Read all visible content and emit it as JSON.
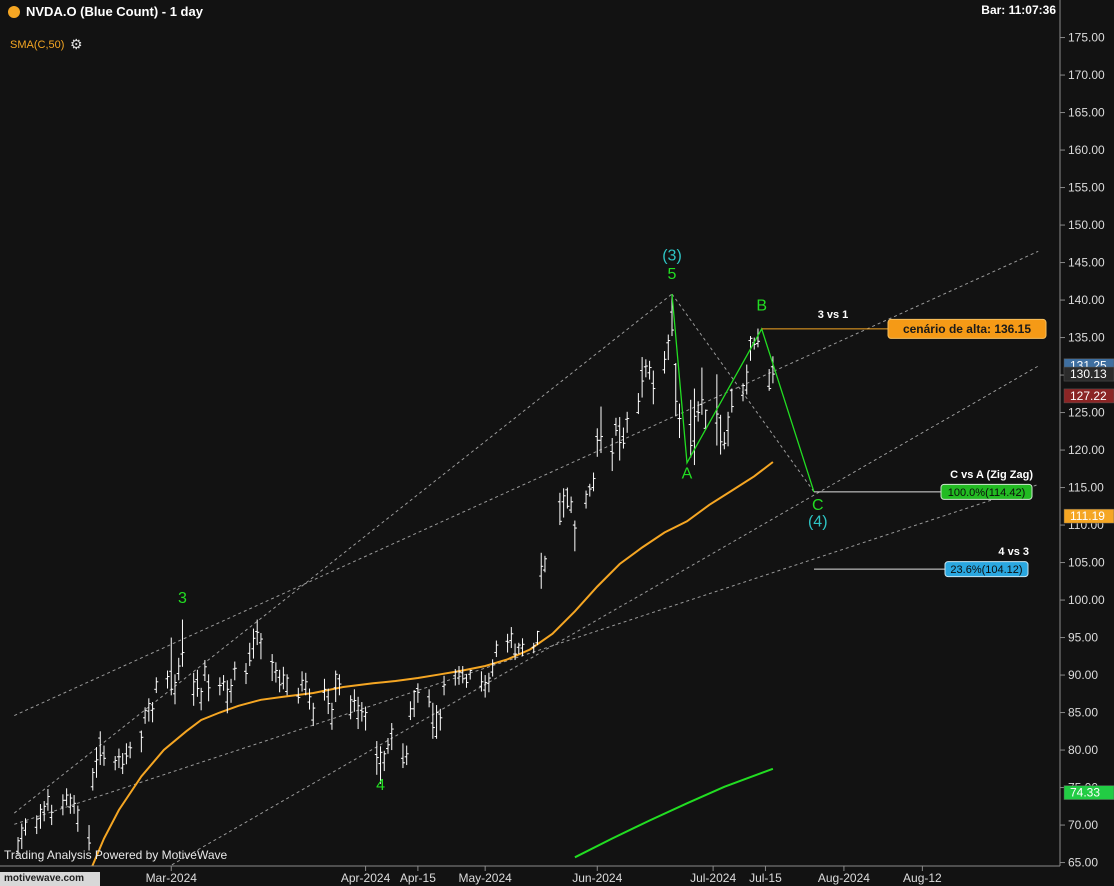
{
  "header": {
    "title": "NVDA.O (Blue Count) - 1 day",
    "bar_time": "Bar: 11:07:36",
    "indicator": "SMA(C,50)",
    "settings_icon": "gear-icon"
  },
  "footer": {
    "powered_by": "Trading Analysis Powered by MotiveWave",
    "logo": "motivewave.com"
  },
  "colors": {
    "background": "#121212",
    "candles": "#ffffff",
    "sma": "#f5a623",
    "wave_green": "#22dd22",
    "wave_cyan": "#2ec4c4",
    "guide": "#9a9a9a"
  },
  "chart_data": {
    "type": "ohlc",
    "x_axis_labels": [
      "Mar-2024",
      "Apr-2024",
      "Apr-15",
      "May-2024",
      "Jun-2024",
      "Jul-2024",
      "Jul-15",
      "Aug-2024",
      "Aug-12"
    ],
    "x_label_day_index": [
      42,
      94,
      108,
      126,
      156,
      187,
      201,
      222,
      243
    ],
    "y_ticks": [
      65,
      70,
      75,
      80,
      85,
      90,
      95,
      100,
      105,
      110,
      115,
      120,
      125,
      130,
      135,
      140,
      145,
      150,
      155,
      160,
      165,
      170,
      175
    ],
    "y_tick_labels": [
      "65.00",
      "70.00",
      "75.00",
      "80.00",
      "85.00",
      "90.00",
      "95.00",
      "100.00",
      "105.00",
      "110.00",
      "115.00",
      "120.00",
      "125.00",
      "130.00",
      "135.00",
      "140.00",
      "145.00",
      "150.00",
      "155.00",
      "160.00",
      "165.00",
      "170.00",
      "175.00"
    ],
    "ylim": [
      63.5,
      176.5
    ],
    "xlim_days": [
      0,
      260
    ],
    "bars": [
      [
        1,
        66.5,
        68.4,
        65.9,
        67.9
      ],
      [
        2,
        68.2,
        70.2,
        66.8,
        69.6
      ],
      [
        3,
        69.3,
        70.9,
        68.6,
        70.4
      ],
      [
        6,
        69.7,
        71.3,
        68.8,
        70.8
      ],
      [
        7,
        70.9,
        72.8,
        69.5,
        72.1
      ],
      [
        8,
        71.7,
        73.2,
        70.5,
        72.5
      ],
      [
        9,
        72.8,
        74.8,
        71.9,
        73.8
      ],
      [
        10,
        71.0,
        72.7,
        70.0,
        71.7
      ],
      [
        13,
        72.4,
        74.1,
        71.3,
        73.3
      ],
      [
        14,
        73.3,
        74.9,
        72.6,
        74.0
      ],
      [
        15,
        72.4,
        74.2,
        71.5,
        73.6
      ],
      [
        16,
        72.5,
        74.0,
        71.5,
        72.9
      ],
      [
        17,
        70.2,
        72.6,
        69.1,
        72.0
      ],
      [
        20,
        68.3,
        70.0,
        66.6,
        67.6
      ],
      [
        21,
        75.1,
        77.6,
        74.6,
        77.0
      ],
      [
        22,
        78.5,
        80.4,
        76.3,
        78.7
      ],
      [
        23,
        81.6,
        82.5,
        78.0,
        79.3
      ],
      [
        24,
        79.6,
        80.6,
        77.9,
        78.9
      ],
      [
        27,
        78.4,
        79.2,
        77.3,
        78.6
      ],
      [
        28,
        79.1,
        80.2,
        77.6,
        79.1
      ],
      [
        29,
        77.6,
        79.6,
        76.8,
        78.1
      ],
      [
        30,
        79.5,
        80.9,
        78.1,
        79.2
      ],
      [
        31,
        80.4,
        81.1,
        78.9,
        80.3
      ],
      [
        34,
        82.4,
        82.6,
        79.7,
        81.7
      ],
      [
        35,
        84.3,
        85.7,
        83.5,
        85.3
      ],
      [
        36,
        85.2,
        86.9,
        83.8,
        86.2
      ],
      [
        37,
        85.3,
        86.4,
        83.7,
        85.5
      ],
      [
        38,
        88.1,
        89.7,
        87.6,
        89.1
      ],
      [
        41,
        89.5,
        90.6,
        88.2,
        89.8
      ],
      [
        42,
        90.5,
        95.0,
        87.3,
        88.1
      ],
      [
        43,
        87.5,
        90.1,
        86.1,
        89.0
      ],
      [
        44,
        90.2,
        92.3,
        89.3,
        91.2
      ],
      [
        45,
        92.8,
        97.4,
        91.1,
        93.0
      ],
      [
        48,
        87.4,
        90.3,
        85.9,
        89.1
      ],
      [
        49,
        89.4,
        90.7,
        87.1,
        88.2
      ],
      [
        50,
        86.3,
        88.3,
        85.3,
        87.8
      ],
      [
        51,
        90.0,
        92.0,
        89.2,
        91.1
      ],
      [
        52,
        89.1,
        90.1,
        86.5,
        88.3
      ],
      [
        55,
        88.6,
        89.7,
        87.3,
        88.6
      ],
      [
        56,
        88.9,
        90.0,
        87.9,
        89.1
      ],
      [
        57,
        86.4,
        89.3,
        84.9,
        88.1
      ],
      [
        58,
        87.8,
        89.5,
        86.3,
        88.6
      ],
      [
        59,
        90.8,
        91.8,
        89.3,
        90.9
      ],
      [
        62,
        90.5,
        91.6,
        88.8,
        90.2
      ],
      [
        63,
        92.9,
        94.3,
        91.2,
        91.9
      ],
      [
        64,
        93.5,
        96.2,
        92.2,
        94.9
      ],
      [
        65,
        95.8,
        97.4,
        94.0,
        95.7
      ],
      [
        66,
        94.3,
        95.6,
        92.1,
        94.8
      ],
      [
        69,
        91.8,
        92.8,
        89.2,
        91.7
      ],
      [
        70,
        90.4,
        91.7,
        89.0,
        90.6
      ],
      [
        71,
        89.7,
        90.7,
        87.7,
        88.7
      ],
      [
        72,
        88.9,
        91.1,
        88.1,
        90.0
      ],
      [
        73,
        87.8,
        90.1,
        87.3,
        89.6
      ],
      [
        76,
        87.2,
        88.3,
        86.2,
        87.0
      ],
      [
        77,
        88.7,
        90.5,
        87.8,
        89.3
      ],
      [
        78,
        88.1,
        90.3,
        87.3,
        89.1
      ],
      [
        79,
        86.4,
        88.2,
        85.4,
        87.1
      ],
      [
        80,
        84.0,
        86.3,
        83.2,
        85.6
      ],
      [
        83,
        87.7,
        89.5,
        86.6,
        88.1
      ],
      [
        84,
        87.1,
        88.2,
        84.8,
        86.2
      ],
      [
        85,
        83.5,
        86.3,
        82.7,
        85.4
      ],
      [
        86,
        88.3,
        90.6,
        86.4,
        90.1
      ],
      [
        87,
        89.5,
        90.1,
        87.3,
        88.8
      ],
      [
        90,
        84.7,
        87.3,
        84.1,
        86.7
      ],
      [
        91,
        86.5,
        88.1,
        85.1,
        86.6
      ],
      [
        92,
        84.2,
        87.1,
        82.8,
        85.9
      ],
      [
        93,
        85.3,
        86.4,
        83.8,
        85.1
      ],
      [
        94,
        84.5,
        85.8,
        82.6,
        85.0
      ],
      [
        97,
        79.4,
        81.2,
        76.7,
        79.0
      ],
      [
        98,
        78.2,
        80.5,
        75.5,
        79.7
      ],
      [
        99,
        78.3,
        79.9,
        77.2,
        79.5
      ],
      [
        100,
        80.2,
        81.6,
        79.5,
        80.7
      ],
      [
        101,
        82.2,
        83.6,
        80.0,
        82.8
      ],
      [
        104,
        78.9,
        80.9,
        77.6,
        78.3
      ],
      [
        105,
        79.1,
        80.6,
        78.0,
        79.5
      ],
      [
        106,
        84.5,
        86.5,
        84.0,
        85.5
      ],
      [
        107,
        85.5,
        88.0,
        84.4,
        87.8
      ],
      [
        108,
        88.2,
        88.9,
        86.3,
        87.7
      ],
      [
        111,
        87.1,
        88.1,
        85.7,
        86.4
      ],
      [
        112,
        83.6,
        86.3,
        81.5,
        83.0
      ],
      [
        113,
        81.8,
        86.0,
        81.5,
        85.0
      ],
      [
        114,
        84.8,
        85.5,
        82.6,
        84.3
      ],
      [
        115,
        88.5,
        89.9,
        87.3,
        88.7
      ],
      [
        118,
        89.9,
        90.8,
        88.6,
        90.4
      ],
      [
        119,
        89.6,
        91.2,
        88.7,
        90.4
      ],
      [
        120,
        90.3,
        91.2,
        88.9,
        89.5
      ],
      [
        121,
        89.6,
        90.1,
        88.3,
        89.0
      ],
      [
        122,
        90.1,
        90.7,
        89.4,
        90.6
      ],
      [
        125,
        88.5,
        90.5,
        87.8,
        89.1
      ],
      [
        126,
        88.0,
        90.0,
        87.0,
        89.0
      ],
      [
        127,
        88.9,
        90.3,
        87.7,
        89.6
      ],
      [
        128,
        90.4,
        92.1,
        89.8,
        91.5
      ],
      [
        129,
        93.0,
        94.6,
        92.4,
        94.0
      ],
      [
        132,
        94.5,
        95.5,
        93.0,
        94.4
      ],
      [
        133,
        94.6,
        96.4,
        93.6,
        95.5
      ],
      [
        134,
        92.8,
        94.2,
        92.0,
        92.8
      ],
      [
        135,
        93.7,
        94.3,
        92.8,
        94.0
      ],
      [
        136,
        93.6,
        94.9,
        92.5,
        94.1
      ],
      [
        139,
        93.7,
        94.3,
        92.9,
        93.9
      ],
      [
        140,
        94.3,
        95.9,
        94.0,
        95.8
      ],
      [
        141,
        103.2,
        106.3,
        101.5,
        104.5
      ],
      [
        142,
        104.0,
        105.9,
        103.7,
        105.5
      ],
      [
        146,
        113.1,
        114.3,
        110.0,
        110.5
      ],
      [
        147,
        113.1,
        114.9,
        111.0,
        113.9
      ],
      [
        148,
        114.7,
        115.0,
        112.2,
        112.5
      ],
      [
        149,
        112.0,
        113.8,
        111.6,
        113.1
      ],
      [
        150,
        110.0,
        110.6,
        106.5,
        109.6
      ],
      [
        153,
        112.9,
        114.6,
        112.2,
        114.1
      ],
      [
        154,
        115.1,
        115.5,
        113.8,
        114.8
      ],
      [
        155,
        115.0,
        117.0,
        114.5,
        116.2
      ],
      [
        156,
        121.8,
        122.9,
        119.1,
        121.3
      ],
      [
        157,
        121.3,
        125.8,
        119.6,
        121.8
      ],
      [
        160,
        119.8,
        121.6,
        117.2,
        119.6
      ],
      [
        161,
        123.4,
        124.3,
        121.9,
        122.6
      ],
      [
        162,
        123.2,
        124.4,
        118.6,
        121.0
      ],
      [
        163,
        121.8,
        123.0,
        120.2,
        120.9
      ],
      [
        164,
        124.1,
        125.1,
        122.3,
        124.2
      ],
      [
        167,
        125.0,
        127.6,
        124.8,
        126.5
      ],
      [
        168,
        130.6,
        132.4,
        127.0,
        129.2
      ],
      [
        169,
        131.1,
        132.1,
        129.7,
        131.2
      ],
      [
        170,
        130.3,
        131.9,
        129.4,
        131.0
      ],
      [
        171,
        128.9,
        130.6,
        126.1,
        128.2
      ],
      [
        174,
        130.7,
        133.2,
        130.2,
        132.1
      ],
      [
        175,
        134.3,
        135.4,
        132.0,
        134.6
      ],
      [
        176,
        138.4,
        140.8,
        135.2,
        136.0
      ],
      [
        177,
        131.4,
        131.6,
        124.5,
        126.5
      ],
      [
        178,
        124.2,
        126.2,
        121.6,
        124.2
      ],
      [
        181,
        123.4,
        126.7,
        119.0,
        120.6
      ],
      [
        182,
        121.2,
        128.2,
        118.0,
        124.5
      ],
      [
        183,
        125.1,
        126.5,
        123.8,
        125.0
      ],
      [
        184,
        126.1,
        131.0,
        124.7,
        126.7
      ],
      [
        185,
        122.9,
        125.4,
        122.7,
        125.3
      ],
      [
        188,
        123.6,
        130.1,
        120.6,
        124.8
      ],
      [
        189,
        124.3,
        124.7,
        119.4,
        121.1
      ],
      [
        190,
        120.7,
        122.4,
        120.1,
        120.9
      ],
      [
        191,
        122.6,
        125.1,
        120.5,
        124.4
      ],
      [
        192,
        128.0,
        128.2,
        125.0,
        125.8
      ],
      [
        195,
        127.3,
        128.9,
        126.5,
        128.6
      ],
      [
        196,
        128.0,
        131.4,
        127.4,
        130.4
      ],
      [
        197,
        134.6,
        135.2,
        131.9,
        134.9
      ],
      [
        198,
        134.3,
        135.0,
        133.4,
        134.1
      ],
      [
        199,
        134.2,
        136.2,
        133.7,
        134.5
      ],
      [
        202,
        128.5,
        130.8,
        127.9,
        128.2
      ],
      [
        203,
        131.1,
        132.5,
        128.9,
        130.13
      ]
    ],
    "sma50": [
      [
        20,
        63.5
      ],
      [
        24,
        68.2
      ],
      [
        28,
        72.0
      ],
      [
        34,
        76.5
      ],
      [
        40,
        80.0
      ],
      [
        46,
        82.5
      ],
      [
        50,
        84.0
      ],
      [
        55,
        85.0
      ],
      [
        60,
        85.9
      ],
      [
        66,
        86.7
      ],
      [
        72,
        87.1
      ],
      [
        80,
        87.6
      ],
      [
        88,
        88.4
      ],
      [
        96,
        88.9
      ],
      [
        102,
        89.2
      ],
      [
        108,
        89.6
      ],
      [
        114,
        90.1
      ],
      [
        120,
        90.6
      ],
      [
        126,
        91.2
      ],
      [
        132,
        92.1
      ],
      [
        138,
        93.4
      ],
      [
        144,
        95.5
      ],
      [
        150,
        98.5
      ],
      [
        156,
        101.8
      ],
      [
        162,
        104.8
      ],
      [
        168,
        107.0
      ],
      [
        174,
        109.0
      ],
      [
        180,
        110.5
      ],
      [
        186,
        112.7
      ],
      [
        192,
        114.6
      ],
      [
        198,
        116.5
      ],
      [
        203,
        118.4
      ]
    ],
    "green_line": [
      [
        150,
        65.7
      ],
      [
        160,
        68.2
      ],
      [
        170,
        70.6
      ],
      [
        180,
        72.9
      ],
      [
        190,
        75.1
      ],
      [
        203,
        77.5
      ]
    ],
    "wave_path": [
      [
        176,
        140.8
      ],
      [
        180,
        118.3
      ],
      [
        200,
        136.15
      ],
      [
        214,
        114.42
      ]
    ],
    "projection_dashes": [
      [
        176,
        140.8
      ],
      [
        214,
        114.42
      ]
    ],
    "channels": [
      {
        "from": [
          0,
          84.6
        ],
        "to": [
          274,
          146.5
        ]
      },
      {
        "from": [
          0,
          70.1
        ],
        "to": [
          274,
          115.4
        ]
      },
      {
        "from": [
          38,
          63.5
        ],
        "to": [
          274,
          131.2
        ]
      },
      {
        "from": [
          0,
          71.6
        ],
        "to": [
          176,
          140.8
        ]
      }
    ],
    "wave_labels": [
      {
        "text": "(3)",
        "x": 176,
        "y": 145.3,
        "color": "cyan"
      },
      {
        "text": "5",
        "x": 176,
        "y": 142.8,
        "color": "green"
      },
      {
        "text": "3",
        "x": 45,
        "y": 99.6,
        "color": "green"
      },
      {
        "text": "4",
        "x": 98,
        "y": 74.7,
        "color": "green"
      },
      {
        "text": "A",
        "x": 180,
        "y": 116.2,
        "color": "green"
      },
      {
        "text": "B",
        "x": 200,
        "y": 138.6,
        "color": "green"
      },
      {
        "text": "C",
        "x": 215,
        "y": 112.0,
        "color": "green"
      },
      {
        "text": "(4)",
        "x": 215,
        "y": 109.8,
        "color": "cyan"
      }
    ],
    "targets": [
      {
        "heading": "3 vs 1",
        "label": "cenário de alta: 136.15",
        "value": 136.15,
        "from_day": 200,
        "style": "orange"
      },
      {
        "heading": "C vs A (Zig Zag)",
        "label": "100.0%(114.42)",
        "value": 114.42,
        "from_day": 214,
        "style": "green"
      },
      {
        "heading": "4 vs 3",
        "label": "23.6%(104.12)",
        "value": 104.12,
        "from_day": 214,
        "style": "blue"
      }
    ],
    "price_tags": [
      {
        "label": "131.25",
        "value": 131.25,
        "color": "#3f6fa0",
        "partial": true
      },
      {
        "label": "130.13",
        "value": 130.13,
        "color": "#2b2b2b"
      },
      {
        "label": "127.22",
        "value": 127.22,
        "color": "#8b2525"
      },
      {
        "label": "111.19",
        "value": 111.19,
        "color": "#f5a623"
      },
      {
        "label": "74.33",
        "value": 74.33,
        "color": "#22cc44"
      }
    ]
  }
}
